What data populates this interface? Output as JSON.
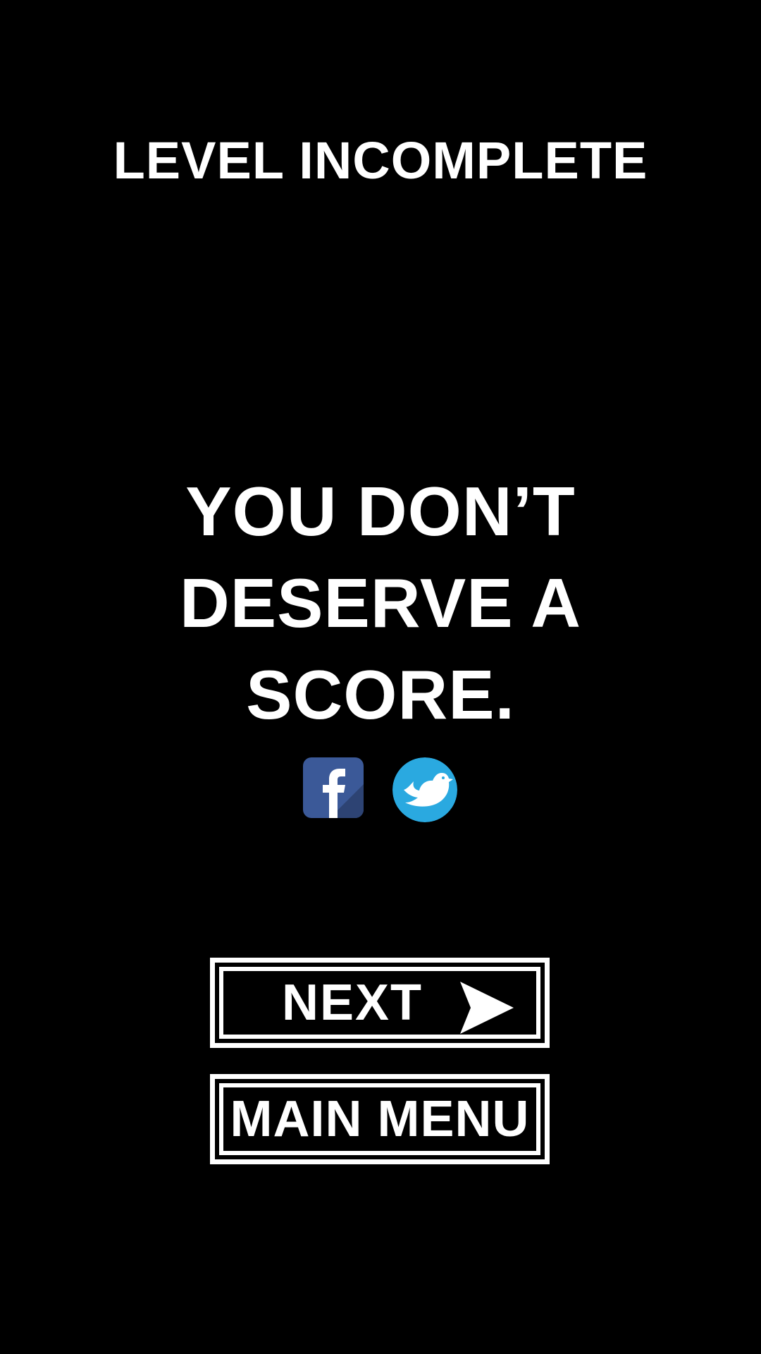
{
  "screen": {
    "title": "LEVEL INCOMPLETE",
    "message_lines": [
      "YOU DON’T",
      "DESERVE A",
      "SCORE."
    ]
  },
  "social": {
    "facebook_icon": "facebook-icon",
    "twitter_icon": "twitter-bird-icon"
  },
  "buttons": {
    "next_label": "NEXT",
    "next_icon": "arrow-right-icon",
    "main_menu_label": "MAIN MENU"
  },
  "colors": {
    "background": "#000000",
    "text": "#ffffff",
    "facebook": "#3b5998",
    "twitter": "#2aa9e0"
  }
}
